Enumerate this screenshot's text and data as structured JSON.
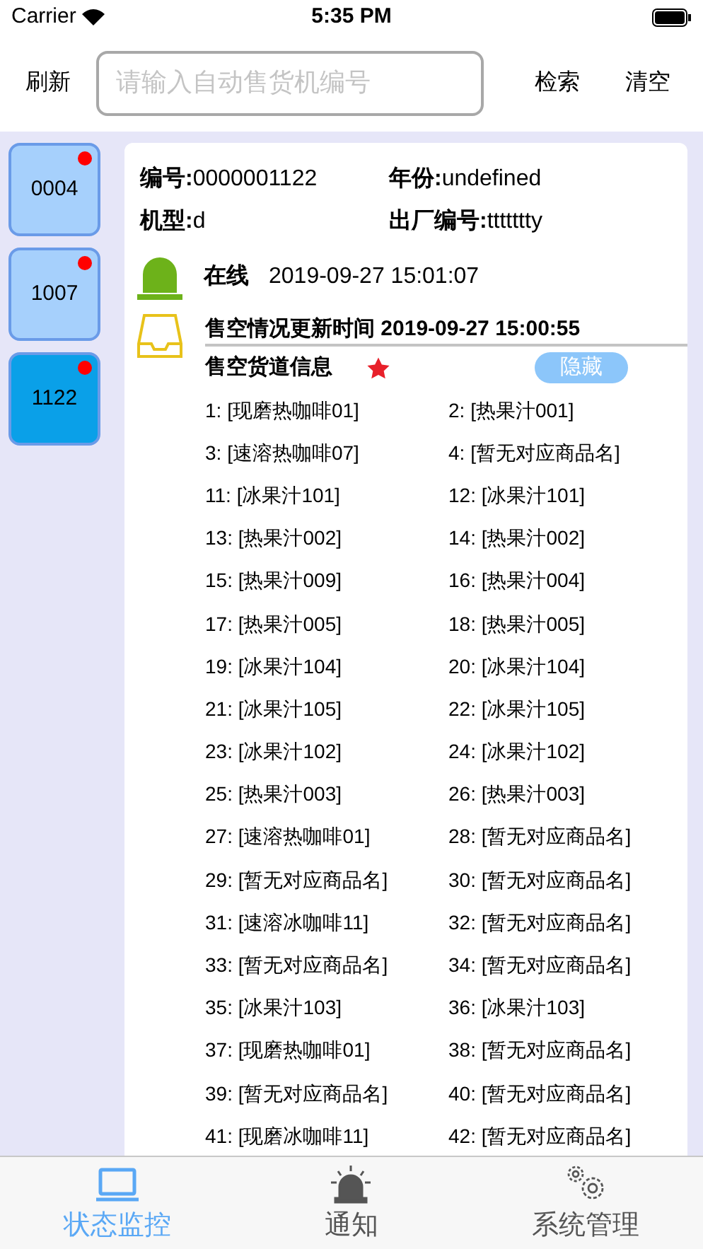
{
  "status_bar": {
    "carrier": "Carrier",
    "time": "5:35 PM"
  },
  "toolbar": {
    "refresh": "刷新",
    "search": {
      "placeholder": "请输入自动售货机编号"
    },
    "search_button": "检索",
    "clear_button": "清空"
  },
  "machines": [
    {
      "label": "0004",
      "selected": false,
      "alert": true
    },
    {
      "label": "1007",
      "selected": false,
      "alert": true
    },
    {
      "label": "1122",
      "selected": true,
      "alert": true
    }
  ],
  "detail": {
    "fields": [
      {
        "label": "编号:",
        "value": "0000001122"
      },
      {
        "label": "年份:",
        "value": "undefined"
      },
      {
        "label": "机型:",
        "value": "d"
      },
      {
        "label": "出厂编号:",
        "value": "ttttttty"
      }
    ],
    "status": {
      "online": true,
      "text": "在线",
      "time": "2019-09-27 15:01:07"
    },
    "soldout_update": "售空情况更新时间 2019-09-27 15:00:55",
    "soldout_title": "售空货道信息",
    "hide_button": "隐藏",
    "slots": [
      "1: [现磨热咖啡01]",
      "2: [热果汁001]",
      "3: [速溶热咖啡07]",
      "4: [暂无对应商品名]",
      "11: [冰果汁101]",
      "12: [冰果汁101]",
      "13: [热果汁002]",
      "14: [热果汁002]",
      "15: [热果汁009]",
      "16: [热果汁004]",
      "17: [热果汁005]",
      "18: [热果汁005]",
      "19: [冰果汁104]",
      "20: [冰果汁104]",
      "21: [冰果汁105]",
      "22: [冰果汁105]",
      "23: [冰果汁102]",
      "24: [冰果汁102]",
      "25: [热果汁003]",
      "26: [热果汁003]",
      "27: [速溶热咖啡01]",
      "28: [暂无对应商品名]",
      "29: [暂无对应商品名]",
      "30: [暂无对应商品名]",
      "31: [速溶冰咖啡11]",
      "32: [暂无对应商品名]",
      "33: [暂无对应商品名]",
      "34: [暂无对应商品名]",
      "35: [冰果汁103]",
      "36: [冰果汁103]",
      "37: [现磨热咖啡01]",
      "38: [暂无对应商品名]",
      "39: [暂无对应商品名]",
      "40: [暂无对应商品名]",
      "41: [现磨冰咖啡11]",
      "42: [暂无对应商品名]"
    ]
  },
  "tabs": [
    {
      "kind": "monitor",
      "label": "状态监控",
      "selected": true
    },
    {
      "kind": "notify",
      "label": "通知",
      "selected": false
    },
    {
      "kind": "settings",
      "label": "系统管理",
      "selected": false
    }
  ]
}
